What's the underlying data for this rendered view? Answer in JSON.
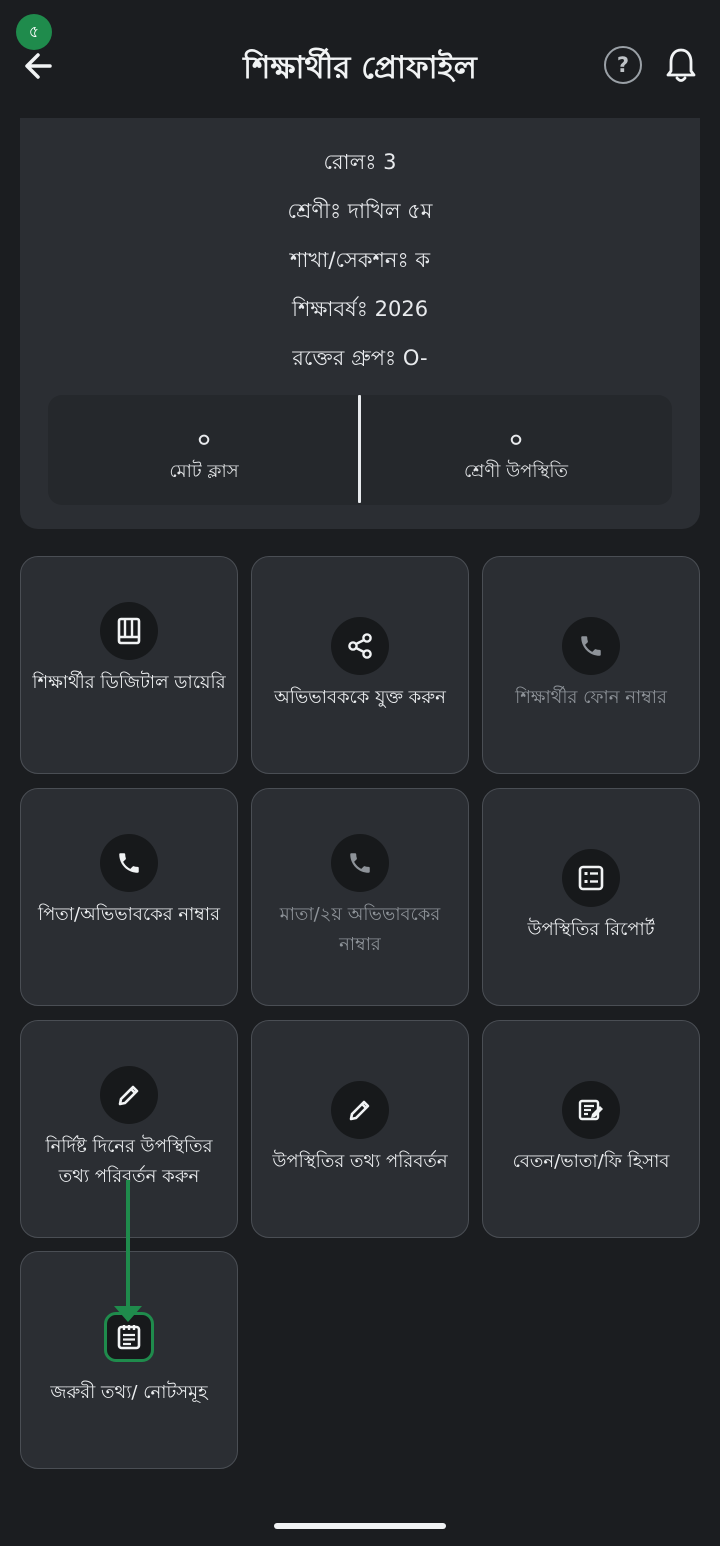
{
  "header": {
    "badge": "৫",
    "title": "শিক্ষার্থীর প্রোফাইল",
    "help": "?"
  },
  "profile": {
    "roll": "রোলঃ 3",
    "class": "শ্রেণীঃ দাখিল ৫ম",
    "section": "শাখা/সেকশনঃ ক",
    "year": "শিক্ষাবর্ষঃ 2026",
    "blood_group": "রক্তের গ্রুপঃ O-"
  },
  "stats": [
    {
      "value": "০",
      "label": "মোট ক্লাস"
    },
    {
      "value": "০",
      "label": "শ্রেণী উপস্থিতি"
    }
  ],
  "tiles": [
    {
      "label": "শিক্ষার্থীর ডিজিটাল ডায়েরি",
      "icon": "book-icon",
      "enabled": true
    },
    {
      "label": "অভিভাবককে যুক্ত করুন",
      "icon": "share-icon",
      "enabled": true
    },
    {
      "label": "শিক্ষার্থীর ফোন নাম্বার",
      "icon": "phone-icon",
      "enabled": false
    },
    {
      "label": "পিতা/অভিভাবকের নাম্বার",
      "icon": "phone-icon",
      "enabled": true
    },
    {
      "label": "মাতা/২য় অভিভাবকের নাম্বার",
      "icon": "phone-icon",
      "enabled": false
    },
    {
      "label": "উপস্থিতির রিপোর্ট",
      "icon": "report-icon",
      "enabled": true
    },
    {
      "label": "নির্দিষ্ট দিনের উপস্থিতির তথ্য পরিবর্তন করুন",
      "icon": "pencil-icon",
      "enabled": true
    },
    {
      "label": "উপস্থিতির তথ্য পরিবর্তন",
      "icon": "pencil-icon",
      "enabled": true
    },
    {
      "label": "বেতন/ভাতা/ফি হিসাব",
      "icon": "edit-note-icon",
      "enabled": true
    },
    {
      "label": "জরুরী তথ্য/ নোটসমূহ",
      "icon": "notepad-icon",
      "enabled": true
    }
  ],
  "colors": {
    "background": "#1b1d20",
    "card": "#2b2e33",
    "accent_green": "#1f8b4c",
    "disabled_text": "#8e9399"
  }
}
